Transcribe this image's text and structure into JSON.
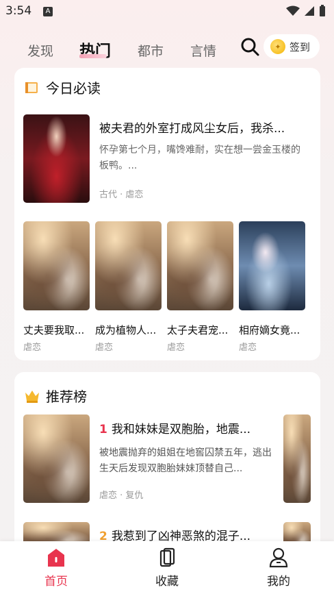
{
  "status_bar": {
    "time": "3:54",
    "notification_glyph": "A"
  },
  "tabs": [
    {
      "label": "发现"
    },
    {
      "label": "热门"
    },
    {
      "label": "都市"
    },
    {
      "label": "言情"
    }
  ],
  "active_tab": "热门",
  "signin_label": "签到",
  "today": {
    "title": "今日必读",
    "featured": {
      "title": "被夫君的外室打成风尘女后，我杀...",
      "desc": "怀孕第七个月，嘴馋难耐，实在想一尝金玉楼的板鸭。...",
      "tags": "古代 · 虐恋"
    },
    "books": [
      {
        "title": "丈夫要我取...",
        "tag": "虐恋"
      },
      {
        "title": "成为植物人...",
        "tag": "虐恋"
      },
      {
        "title": "太子夫君宠...",
        "tag": "虐恋"
      },
      {
        "title": "相府嫡女竟...",
        "tag": "虐恋"
      }
    ]
  },
  "ranking": {
    "title": "推荐榜",
    "items": [
      {
        "rank": "1",
        "title": "我和妹妹是双胞胎，地震...",
        "desc": "被地震抛弃的姐姐在地窖囚禁五年，逃出生天后发现双胞胎妹妹顶替自己...",
        "tags": "虐恋 · 复仇"
      },
      {
        "rank": "2",
        "title": "我惹到了凶神恶煞的混子..."
      }
    ]
  },
  "bottom_nav": [
    {
      "label": "首页"
    },
    {
      "label": "收藏"
    },
    {
      "label": "我的"
    }
  ],
  "colors": {
    "accent": "#e8344e",
    "rank1": "#e8344e",
    "rank2": "#f0a030"
  }
}
